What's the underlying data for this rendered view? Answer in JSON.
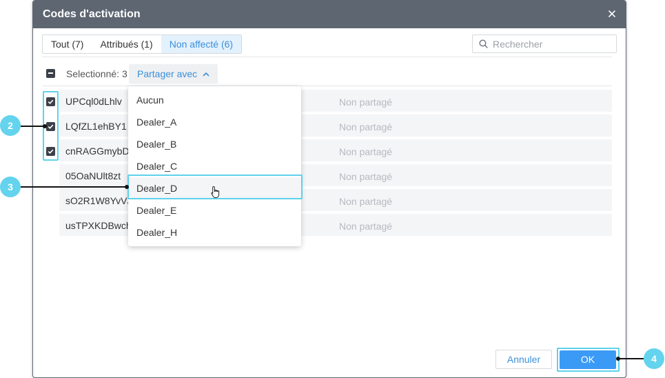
{
  "dialog": {
    "title": "Codes d'activation",
    "close_icon": "close-icon"
  },
  "tabs": [
    {
      "label": "Tout (7)",
      "active": false
    },
    {
      "label": "Attribués (1)",
      "active": false
    },
    {
      "label": "Non affecté (6)",
      "active": true
    }
  ],
  "search": {
    "placeholder": "Rechercher",
    "icon": "search-icon"
  },
  "toolbar": {
    "selected_label": "Selectionné: 3",
    "share_label": "Partager avec"
  },
  "rows": [
    {
      "code": "UPCql0dLhlv",
      "status": "Non partagé",
      "checked": true
    },
    {
      "code": "LQfZL1ehBY1",
      "status": "Non partagé",
      "checked": true
    },
    {
      "code": "cnRAGGmybDh",
      "status": "Non partagé",
      "checked": true
    },
    {
      "code": "05OaNUlt8zt",
      "status": "Non partagé",
      "checked": false
    },
    {
      "code": "sO2R1W8YvVJ",
      "status": "Non partagé",
      "checked": false
    },
    {
      "code": "usTPXKDBwch",
      "status": "Non partagé",
      "checked": false
    }
  ],
  "dropdown": {
    "options": [
      "Aucun",
      "Dealer_A",
      "Dealer_B",
      "Dealer_C",
      "Dealer_D",
      "Dealer_E",
      "Dealer_H"
    ],
    "hovered": "Dealer_D"
  },
  "footer": {
    "cancel_label": "Annuler",
    "ok_label": "OK"
  },
  "callouts": [
    "2",
    "3",
    "4"
  ],
  "colors": {
    "accent": "#3b9af5",
    "link": "#3b8fdb",
    "highlight": "#5ed1ec",
    "titlebar": "#5e6672",
    "callout": "#64d3ed"
  }
}
